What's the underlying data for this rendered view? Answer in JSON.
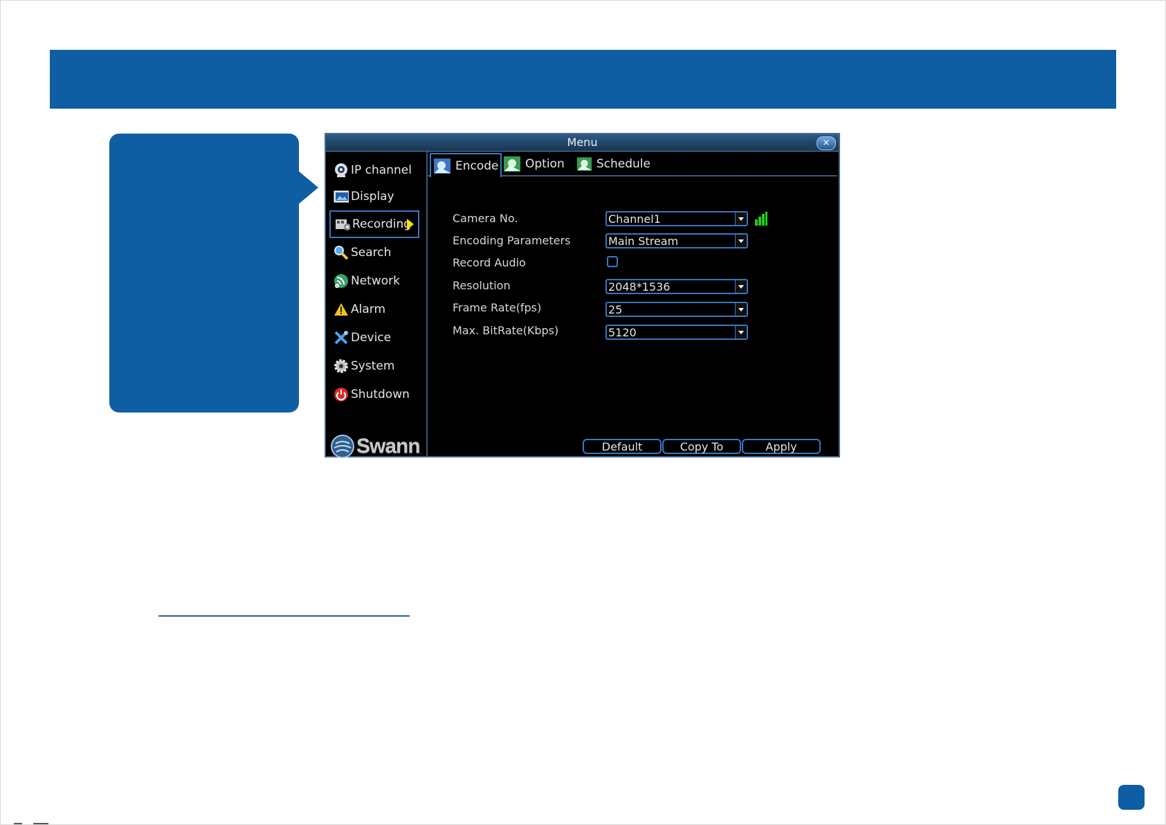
{
  "window": {
    "title": "Menu",
    "close_glyph": "×"
  },
  "sidebar": {
    "items": [
      {
        "label": "IP channel",
        "icon": "ip-camera-icon"
      },
      {
        "label": "Display",
        "icon": "display-icon"
      },
      {
        "label": "Recording",
        "icon": "recording-icon",
        "active": true
      },
      {
        "label": "Search",
        "icon": "search-icon"
      },
      {
        "label": "Network",
        "icon": "network-icon"
      },
      {
        "label": "Alarm",
        "icon": "alarm-icon"
      },
      {
        "label": "Device",
        "icon": "device-icon"
      },
      {
        "label": "System",
        "icon": "system-gear-icon"
      },
      {
        "label": "Shutdown",
        "icon": "power-icon"
      }
    ]
  },
  "logo": {
    "text": "Swann",
    "tm": "."
  },
  "tabs": [
    {
      "label": "Encode",
      "active": true
    },
    {
      "label": "Option"
    },
    {
      "label": "Schedule"
    }
  ],
  "form": {
    "camera_no": {
      "label": "Camera No.",
      "value": "Channel1"
    },
    "encoding_parameters": {
      "label": "Encoding Parameters",
      "value": "Main Stream"
    },
    "record_audio": {
      "label": "Record Audio",
      "checked": false
    },
    "resolution": {
      "label": "Resolution",
      "value": "2048*1536"
    },
    "frame_rate": {
      "label": "Frame Rate(fps)",
      "value": "25"
    },
    "max_bitrate": {
      "label": "Max. BitRate(Kbps)",
      "value": "5120"
    }
  },
  "buttons": {
    "default": "Default",
    "copy_to": "Copy To",
    "apply": "Apply"
  },
  "colors": {
    "brand_blue": "#0f5ea3",
    "selection_border": "#3a78c2",
    "selection_arrow": "#ffe200",
    "signal_green": "#22cc22"
  }
}
